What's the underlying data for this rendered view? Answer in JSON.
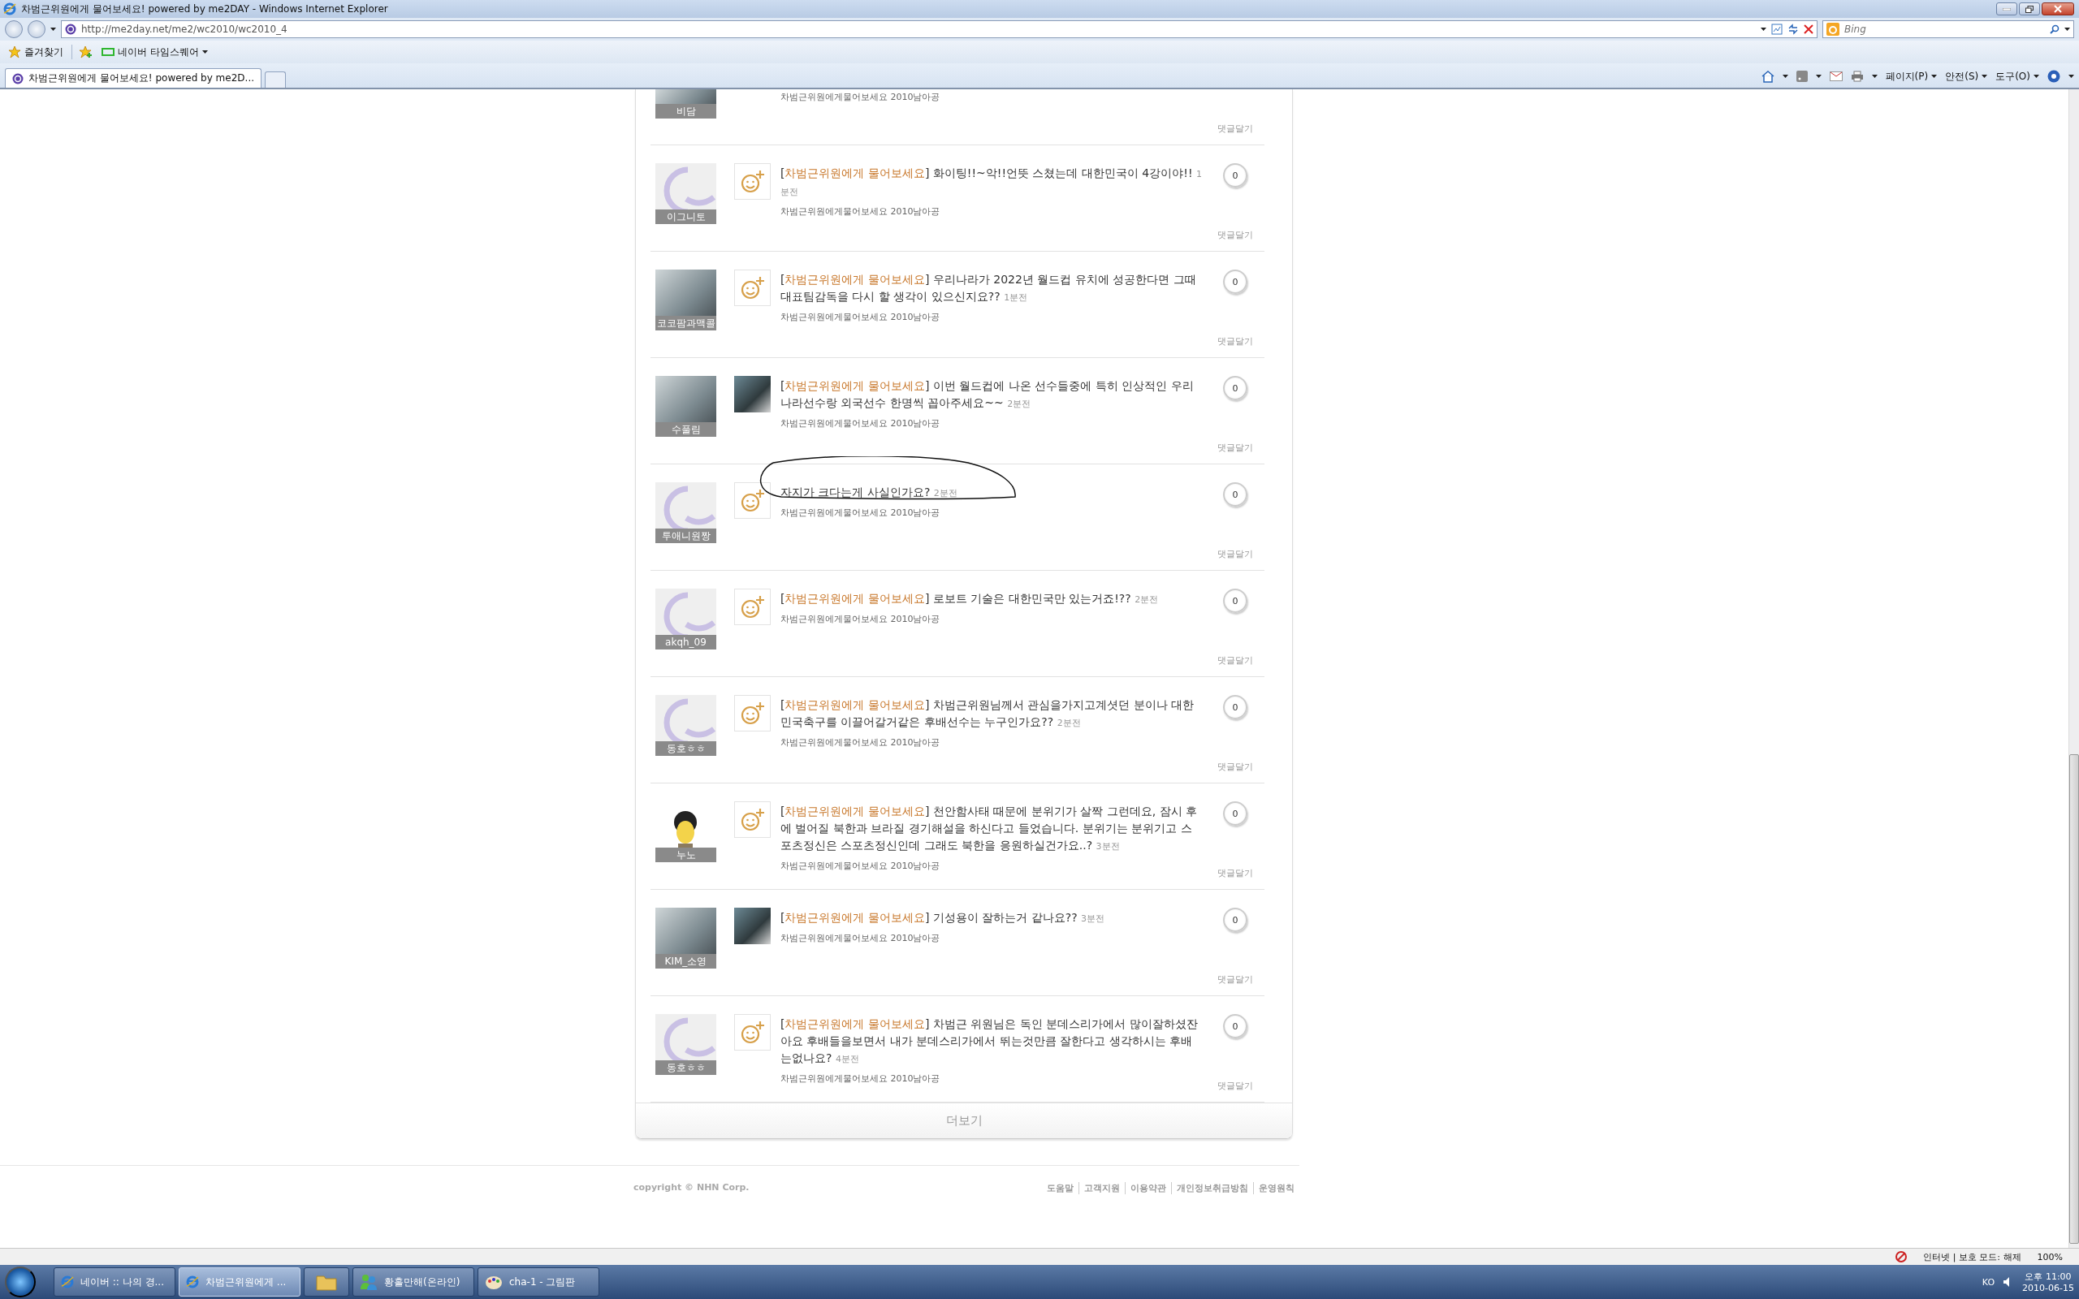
{
  "window": {
    "title": "차범근위원에게 물어보세요! powered by me2DAY - Windows Internet Explorer"
  },
  "address_bar": {
    "url": "http://me2day.net/me2/wc2010/wc2010_4"
  },
  "search": {
    "placeholder": "Bing"
  },
  "favorites_bar": {
    "favorites": "즐겨찾기",
    "items": [
      "네이버 타임스퀘어"
    ]
  },
  "tabs": [
    {
      "label": "차범근위원에게 물어보세요! powered by me2D...",
      "selected": true
    }
  ],
  "command_bar": {
    "menus": [
      "페이지(P)",
      "안전(S)",
      "도구(O)"
    ]
  },
  "posts": [
    {
      "user": "비담",
      "avatar": {
        "kind": "photo"
      },
      "circled": false,
      "meta": "차범근위원에게물어보세요 2010남아공",
      "reply": "댓글달기"
    },
    {
      "user": "이그니토",
      "avatar": {
        "kind": "default"
      },
      "attachment": {
        "kind": "smiley"
      },
      "circled": false,
      "tag": {
        "open": "[",
        "text": "차범근위원에게 물어보세요",
        "close": "]"
      },
      "text": "화이팅!!~악!!언뜻 스쳤는데 대한민국이 4강이야!!",
      "time": "1분전",
      "meta": "차범근위원에게물어보세요 2010남아공",
      "count": "0",
      "reply": "댓글달기"
    },
    {
      "user": "코코팜과맥콜",
      "avatar": {
        "kind": "photo"
      },
      "attachment": {
        "kind": "smiley"
      },
      "circled": false,
      "tag": {
        "open": "[",
        "text": "차범근위원에게 물어보세요",
        "close": "]"
      },
      "text": "우리나라가 2022년 월드컵 유치에 성공한다면 그때 대표팀감독을 다시 할 생각이 있으신지요??",
      "time": "1분전",
      "meta": "차범근위원에게물어보세요 2010남아공",
      "count": "0",
      "reply": "댓글달기"
    },
    {
      "user": "수풀림",
      "avatar": {
        "kind": "photo"
      },
      "attachment": {
        "kind": "photo"
      },
      "circled": false,
      "tag": {
        "open": "[",
        "text": "차범근위원에게 물어보세요",
        "close": "]"
      },
      "text": "이번 월드컵에 나온 선수들중에 특히 인상적인 우리나라선수랑 외국선수 한명씩 꼽아주세요~~",
      "time": "2분전",
      "meta": "차범근위원에게물어보세요 2010남아공",
      "count": "0",
      "reply": "댓글달기"
    },
    {
      "user": "투애니원짱",
      "avatar": {
        "kind": "default"
      },
      "attachment": {
        "kind": "smiley"
      },
      "circled": true,
      "text": "자지가 크다는게 사실인가요?",
      "time": "2분전",
      "meta": "차범근위원에게물어보세요 2010남아공",
      "count": "0",
      "reply": "댓글달기"
    },
    {
      "user": "akqh_09",
      "avatar": {
        "kind": "default"
      },
      "attachment": {
        "kind": "smiley"
      },
      "circled": false,
      "tag": {
        "open": "[",
        "text": "차범근위원에게 물어보세요",
        "close": "]"
      },
      "text": "로보트 기술은 대한민국만 있는거죠!??",
      "time": "2분전",
      "meta": "차범근위원에게물어보세요 2010남아공",
      "count": "0",
      "reply": "댓글달기"
    },
    {
      "user": "동호ㅎㅎ",
      "avatar": {
        "kind": "default"
      },
      "attachment": {
        "kind": "smiley"
      },
      "circled": false,
      "tag": {
        "open": "[",
        "text": "차범근위원에게 물어보세요",
        "close": "]"
      },
      "text": "차범근위원님께서 관심을가지고계셧던 분이나 대한민국축구를 이끌어갈거같은 후배선수는 누구인가요??",
      "time": "2분전",
      "meta": "차범근위원에게물어보세요 2010남아공",
      "count": "0",
      "reply": "댓글달기"
    },
    {
      "user": "누노",
      "avatar": {
        "kind": "cartoon"
      },
      "attachment": {
        "kind": "smiley"
      },
      "circled": false,
      "tag": {
        "open": "[",
        "text": "차범근위원에게 물어보세요",
        "close": "]"
      },
      "text": "천안함사태 때문에 분위기가 살짝 그런데요, 잠시 후에 벌어질 북한과 브라질 경기해설을 하신다고 들었습니다. 분위기는 분위기고 스포츠정신은 스포츠정신인데 그래도 북한을 응원하실건가요..?",
      "time": "3분전",
      "meta": "차범근위원에게물어보세요 2010남아공",
      "count": "0",
      "reply": "댓글달기"
    },
    {
      "user": "KIM_소영",
      "avatar": {
        "kind": "photo"
      },
      "attachment": {
        "kind": "photo"
      },
      "circled": false,
      "tag": {
        "open": "[",
        "text": "차범근위원에게 물어보세요",
        "close": "]"
      },
      "text": "기성용이 잘하는거 같나요??",
      "time": "3분전",
      "meta": "차범근위원에게물어보세요 2010남아공",
      "count": "0",
      "reply": "댓글달기"
    },
    {
      "user": "동호ㅎㅎ",
      "avatar": {
        "kind": "default"
      },
      "attachment": {
        "kind": "smiley"
      },
      "circled": false,
      "tag": {
        "open": "[",
        "text": "차범근위원에게 물어보세요",
        "close": "]"
      },
      "text": "차범근 위원님은 독인 분데스리가에서 많이잘하셨잔아요 후배들을보면서 내가 분데스리가에서 뛰는것만큼 잘한다고 생각하시는 후배는없나요?",
      "time": "4분전",
      "meta": "차범근위원에게물어보세요 2010남아공",
      "count": "0",
      "reply": "댓글달기"
    }
  ],
  "more_button": "더보기",
  "footer": {
    "copyright": "copyright © NHN Corp.",
    "links": [
      "도움말",
      "고객지원",
      "이용약관",
      "개인정보취급방침",
      "운영원칙"
    ]
  },
  "status_bar": {
    "zone": "인터넷 | 보호 모드: 해제",
    "zoom": "100%"
  },
  "taskbar": {
    "items": [
      {
        "kind": "ie",
        "label": "네이버 :: 나의 경...",
        "selected": false
      },
      {
        "kind": "ie",
        "label": "차범근위원에게 ...",
        "selected": true
      },
      {
        "kind": "folder",
        "selected": false
      },
      {
        "kind": "messenger",
        "label": "황홀만해(온라인)",
        "selected": false
      },
      {
        "kind": "paint",
        "label": "cha-1 - 그림판",
        "selected": false
      }
    ],
    "language": "KO",
    "time": "오후 11:00",
    "date": "2010-06-15"
  }
}
